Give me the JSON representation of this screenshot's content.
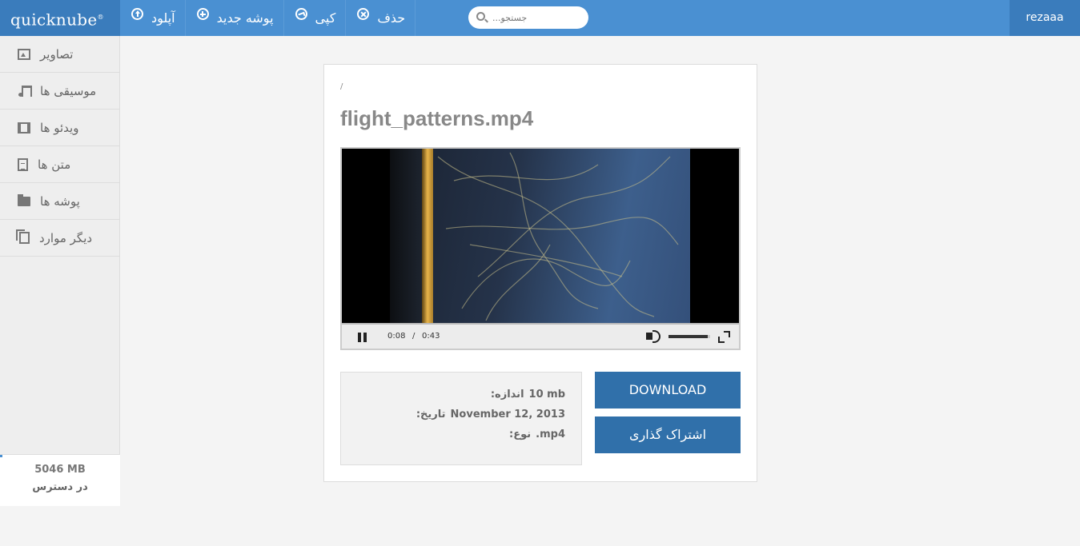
{
  "app": {
    "logo": "quicknube",
    "logo_mark": "®"
  },
  "toolbar": {
    "upload_label": "آپلود",
    "new_folder_label": "پوشه جدید",
    "copy_label": "کپی",
    "delete_label": "حذف"
  },
  "search": {
    "placeholder": "...جستجو"
  },
  "user": {
    "name": "rezaaa"
  },
  "sidebar": {
    "items": [
      {
        "label": "تصاویر",
        "icon": "image-icon"
      },
      {
        "label": "موسیقی ها",
        "icon": "music-icon"
      },
      {
        "label": "ویدئو ها",
        "icon": "film-icon"
      },
      {
        "label": "متن ها",
        "icon": "document-icon"
      },
      {
        "label": "پوشه ها",
        "icon": "folder-icon"
      },
      {
        "label": "دیگر موارد",
        "icon": "files-icon"
      }
    ]
  },
  "storage": {
    "amount": "5046 MB",
    "label": "در دسترس",
    "used_fraction": 0.02
  },
  "file": {
    "breadcrumb": "/",
    "name": "flight_patterns.mp4"
  },
  "player": {
    "current_time": "0:08",
    "separator": "/",
    "duration": "0:43",
    "volume_fraction": 0.95
  },
  "details": {
    "size_label": "اندازه:",
    "size_value": "10 mb",
    "date_label": "تاریخ:",
    "date_value": "November 12, 2013",
    "type_label": "نوع:",
    "type_value": ".mp4"
  },
  "actions": {
    "download_label": "DOWNLOAD",
    "share_label": "اشتراک گذاری"
  },
  "colors": {
    "topbar": "#4a90d2",
    "logo_bg": "#3a7cbc",
    "button": "#3070aa"
  }
}
